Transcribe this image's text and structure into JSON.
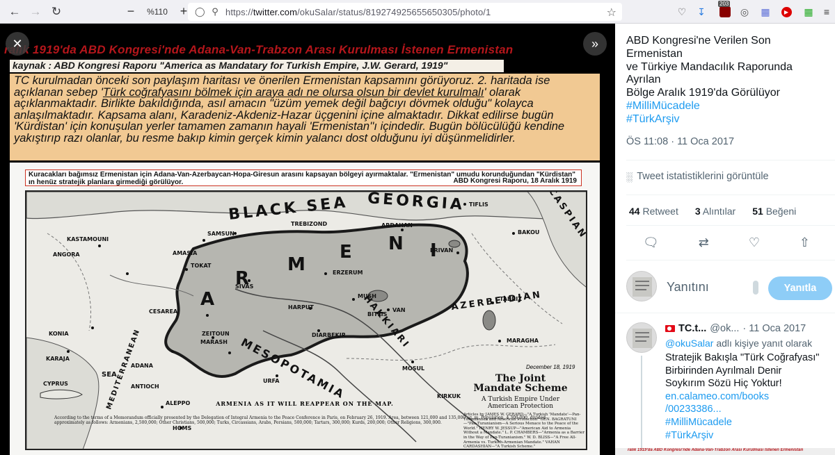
{
  "browser": {
    "url_prefix": "https://",
    "url_host": "twitter.com",
    "url_path": "/okuSalar/status/819274925655650305/photo/1",
    "zoom": "%110",
    "badge_count": "203",
    "accent": "#1d9bf0"
  },
  "image": {
    "title": "ralık 1919'da ABD Kongresi'nde Adana-Van-Trabzon Arası Kurulması İstenen Ermenistan",
    "source": "kaynak : ABD Kongresi Raporu \"America as Mandatary for Turkish Empire, J.W. Gerard, 1919\"",
    "desc_1": "TC kurulmadan önceki son paylaşım haritası ve önerilen Ermenistan kapsamını görüyoruz. 2. haritada ise açıklanan sebep '",
    "desc_underline": "Türk coğrafyasını bölmek için araya adı ne olursa olsun bir devlet kurulmalı",
    "desc_2": "' olarak açıklanmaktadır. Birlikte bakıldığında, asıl amacın \"üzüm yemek değil bağcıyı dövmek olduğu\" kolayca anlaşılmaktadır. Kapsama alanı, Karadeniz-Akdeniz-Hazar üçgenini  içine almaktadır. Dikkat edilirse bugün 'Kürdistan' için konuşulan yerler tamamen zamanın hayali 'Ermenistan''ı içindedir. Bugün bölücülüğü kendine yakıştırıp razı olanlar, bu resme bakıp kimin gerçek kimin yalancı dost olduğunu iyi düşünmelidirler.",
    "caption": "Kuracakları bağımsız Ermenistan için Adana-Van-Azerbaycan-Hopa-Giresun arasını kapsayan bölgeyi ayırmaktalar.  \"Ermenistan\" umudu korunduğundan \"Kürdistan\" ın henüz stratejik planlara girmediği görülüyor.",
    "caption_right": "ABD Kongresi Raporu, 18 Aralık 1919",
    "map_labels": {
      "black_sea": "BLACK SEA",
      "georgia": "GEORGIA",
      "caspian": "CASPIAN",
      "armenia_a": "A",
      "armenia_r": "R",
      "armenia_m": "M",
      "armenia_e": "E",
      "armenia_n": "N",
      "armenia_i": "I",
      "azerbeidjan": "AZERBEIDJAN",
      "hakkiari": "HAKKIARI",
      "mesopotamia": "MESOPOTAMIA",
      "mediterranean": "MEDITERRANEAN",
      "sea": "SEA",
      "cyprus": "CYPRUS",
      "kastamouni": "KASTAMOUNI",
      "angora": "ANGORA",
      "konia": "KONIA",
      "karaja": "KARAJA",
      "adana": "ADANA",
      "aleppo": "ALEPPO",
      "antioch": "ANTIOCH",
      "homs": "HOMS",
      "tiflis": "TIFLIS",
      "ardahan": "ARDAHAN",
      "bakou": "BAKOU",
      "erivan": "ERIVAN",
      "erzerum": "ERZERUM",
      "kharput": "HARPUT",
      "diarbekir": "DIARBEKIR",
      "sivas": "SIVAS",
      "cesarea": "CESAREA",
      "marash": "MARASH",
      "zeitoun": "ZEITOUN",
      "urfa": "URFA",
      "mosul": "MOSUL",
      "kirkuk": "KIRKUK",
      "bitlis": "BITLIS",
      "van": "VAN",
      "mush": "MUSH",
      "trebizond": "TREBIZOND",
      "samsun": "SAMSUN",
      "tokat": "TOKAT",
      "amasia": "AMASIA",
      "maragha": "MARAGHA",
      "tabriz": "TABRIZ"
    },
    "legend": {
      "date": "December 18, 1919",
      "title": "The Joint Mandate Scheme",
      "subtitle": "A Turkish Empire Under American Protection",
      "articles": "Articles by JAMES W. GERARD—\"A Turkish 'Mandate'—Pan-Turanianism and American Protection\" GEN. BAGRATUNI—\"Pan-Turanianism—A Serious Menace to the Peace of the World.\" HENRY W. JESSUP—\"American Aid to Armenia Without a Mandate.\" L. P. CHAMBERS—\"Armenia as a Barrier in the Way of Pan-Turanianism.\" W. D. BLISS—\"A Free All-Armenia vs. Turkish-Armenian Mandate.\" VAHAN CARDASHIAN—\"A Turkish Scheme.\""
    },
    "map_bottom": "ARMENIA AS IT WILL REAPPEAR ON THE MAP.",
    "map_foot": "According to the terms of a Memorandum officially presented by the Delegation of Integral Armenia to the Peace Conference in Paris, on February 26, 1919. Area, between 121,000 and 135,000 sq. m. Population, 4,300,000, divided approximately as follows: Armenians, 2,500,000; Other Christians, 500,000; Turks, Circassians, Arabs, Persians, 500,000; Tartars, 300,000; Kurds, 200,000; Other Religions, 300,000."
  },
  "tweet": {
    "text_lines": [
      "ABD Kongresi'ne Verilen Son",
      "Ermenistan",
      "ve Türkiye Mandacılık Raporunda",
      "Ayrılan",
      "Bölge Aralık 1919'da Görülüyor"
    ],
    "hashtag_1": "#MilliMücadele",
    "hashtag_2": "#TürkArşiv",
    "time": "ÖS 11:08 · 11 Oca 2017",
    "stats_link": "Tweet istatistiklerini görüntüle",
    "retweet_count": "44",
    "retweet_label": "Retweet",
    "quote_count": "3",
    "quote_label": "Alıntılar",
    "like_count": "51",
    "like_label": "Beğeni"
  },
  "reply_box": {
    "placeholder": "Yanıtını",
    "button": "Yanıtla"
  },
  "reply_tweet": {
    "name": "TC.t...",
    "handle": "@ok...",
    "date": "· 11 Oca 2017",
    "reply_to_handle": "@okuSalar",
    "reply_to_suffix": "adlı kişiye yanıt olarak",
    "body_lines": [
      "Stratejik Bakışla \"Türk Coğrafyası\"",
      "Birbirinden Ayrılmalı Denir",
      "Soykırım Sözü Hiç Yoktur!"
    ],
    "link_1": "en.calameo.com/books",
    "link_2": "/00233386...",
    "hashtag_1": "#MilliMücadele",
    "hashtag_2": "#TürkArşiv"
  },
  "bottom_thumb_text": "ralık 1919'da ABD Kongresi'nde Adana-Van-Trabzon Arası Kurulması İstenen Ermenistan"
}
